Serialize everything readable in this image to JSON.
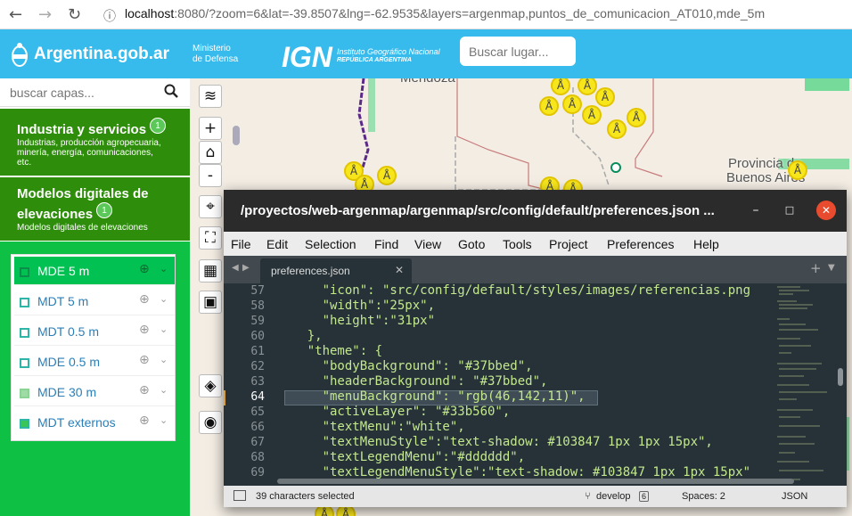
{
  "browser": {
    "back": "←",
    "forward": "→",
    "reload": "↻",
    "info": "ⓘ",
    "url_host": "localhost",
    "url_rest": ":8080/?zoom=6&lat=-39.8507&lng=-62.9535&layers=argenmap,puntos_de_comunicacion_AT010,mde_5m"
  },
  "header": {
    "brand": "Argentina.gob.ar",
    "ministerio_line1": "Ministerio",
    "ministerio_line2": "de Defensa",
    "ign_mark": "IGN",
    "ign_line1": "Instituto Geográfico Nacional",
    "ign_line2": "REPÚBLICA ARGENTINA",
    "search_placeholder": "Buscar lugar...",
    "color": "#37bbed"
  },
  "sidebar": {
    "search_placeholder": "buscar capas...",
    "groups": [
      {
        "title": "Industria y servicios",
        "badge": "1",
        "subtitle": "Industrias, producción agropecuaria, minería, energía, comunicaciones, etc."
      },
      {
        "title_line1": "Modelos digitales de",
        "title_line2": "elevaciones",
        "badge": "1",
        "subtitle": "Modelos digitales de elevaciones"
      }
    ],
    "layers": [
      {
        "label": "MDE 5 m",
        "active": true
      },
      {
        "label": "MDT 5 m",
        "active": false
      },
      {
        "label": "MDT 0.5 m",
        "active": false
      },
      {
        "label": "MDE 0.5 m",
        "active": false
      },
      {
        "label": "MDE 30 m",
        "active": false
      },
      {
        "label": "MDT externos",
        "active": false
      }
    ],
    "group_color": "#2e8e0b"
  },
  "map": {
    "labels": [
      "Mendoza",
      "Provincia de",
      "Buenos Aires"
    ],
    "controls": [
      "layers-icon",
      "zoom-in",
      "home",
      "zoom-out",
      "locate",
      "fullscreen",
      "graticule",
      "print",
      "add-layer",
      "screenshot"
    ],
    "zoom_in": "+",
    "zoom_out": "-"
  },
  "editor": {
    "title": "/proyectos/web-argenmap/argenmap/src/config/default/preferences.json ...",
    "menu": [
      "File",
      "Edit",
      "Selection",
      "Find",
      "View",
      "Goto",
      "Tools",
      "Project",
      "Preferences",
      "Help"
    ],
    "tab_name": "preferences.json",
    "lines": [
      {
        "num": "57",
        "text": "      \"icon\": \"src/config/default/styles/images/referencias.png"
      },
      {
        "num": "58",
        "text": "      \"width\":\"25px\","
      },
      {
        "num": "59",
        "text": "      \"height\":\"31px\""
      },
      {
        "num": "60",
        "text": "    },"
      },
      {
        "num": "61",
        "text": "    \"theme\": {"
      },
      {
        "num": "62",
        "text": "      \"bodyBackground\": \"#37bbed\","
      },
      {
        "num": "63",
        "text": "      \"headerBackground\": \"#37bbed\","
      },
      {
        "num": "64",
        "text": "      \"menuBackground\": \"rgb(46,142,11)\","
      },
      {
        "num": "65",
        "text": "      \"activeLayer\": \"#33b560\","
      },
      {
        "num": "66",
        "text": "      \"textMenu\":\"white\","
      },
      {
        "num": "67",
        "text": "      \"textMenuStyle\":\"text-shadow: #103847 1px 1px 15px\","
      },
      {
        "num": "68",
        "text": "      \"textLegendMenu\":\"#dddddd\","
      },
      {
        "num": "69",
        "text": "      \"textLegendMenuStyle\":\"text-shadow: #103847 1px 1px 15px\""
      }
    ],
    "current_line": "64",
    "status": {
      "selection": "39 characters selected",
      "branch": "develop",
      "branch_count": "6",
      "spaces": "Spaces: 2",
      "syntax": "JSON"
    }
  }
}
